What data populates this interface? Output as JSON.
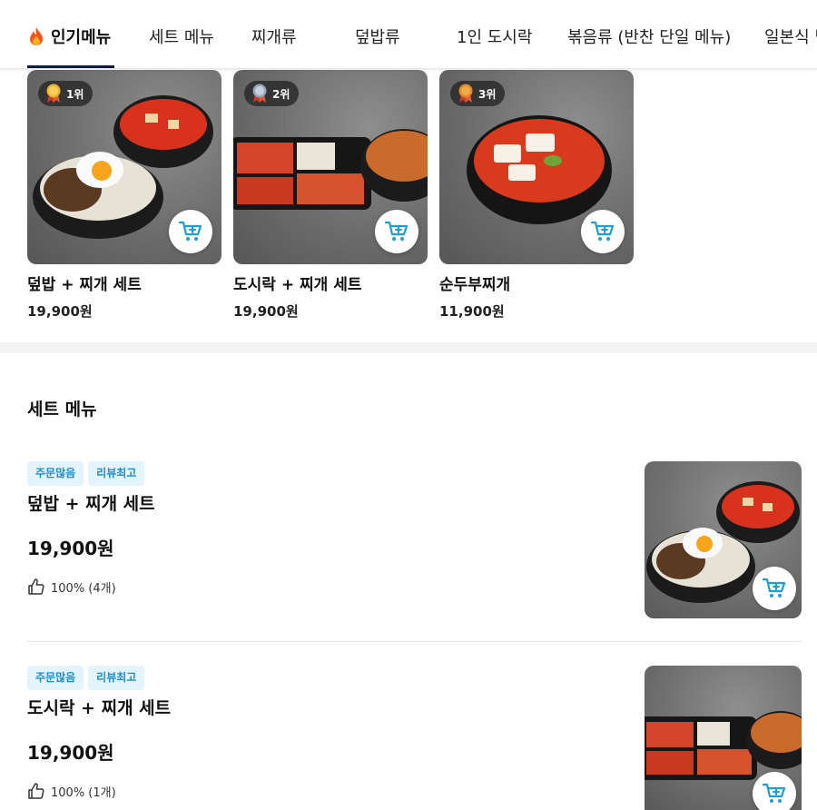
{
  "tabs": [
    {
      "label": "인기메뉴",
      "active": true
    },
    {
      "label": "세트 메뉴"
    },
    {
      "label": "찌개류"
    },
    {
      "label": "덮밥류"
    },
    {
      "label": "1인 도시락"
    },
    {
      "label": "볶음류 (반찬 단일 메뉴)"
    },
    {
      "label": "일본식 덮밥"
    }
  ],
  "popular": [
    {
      "rank": "1위",
      "medal": "gold",
      "name": "덮밥 + 찌개 세트",
      "price": "19,900원"
    },
    {
      "rank": "2위",
      "medal": "silver",
      "name": "도시락 + 찌개 세트",
      "price": "19,900원"
    },
    {
      "rank": "3위",
      "medal": "bronze",
      "name": "순두부찌개",
      "price": "11,900원"
    }
  ],
  "section": {
    "title": "세트 메뉴"
  },
  "items": [
    {
      "badges": [
        "주문많음",
        "리뷰최고"
      ],
      "name": "덮밥 + 찌개 세트",
      "price": "19,900원",
      "rating": "100% (4개)"
    },
    {
      "badges": [
        "주문많음",
        "리뷰최고"
      ],
      "name": "도시락 + 찌개 세트",
      "price": "19,900원",
      "rating": "100% (1개)"
    }
  ],
  "colors": {
    "accent": "#1f8dcf",
    "badge_bg": "#e3f4fd",
    "tab_indicator": "#141a3a",
    "cart_icon": "#1aa0d8"
  },
  "icons": {
    "tab_hot": "flame-icon",
    "cart": "cart-plus-icon",
    "rating": "thumbs-up-icon",
    "rank": "medal-icon"
  }
}
